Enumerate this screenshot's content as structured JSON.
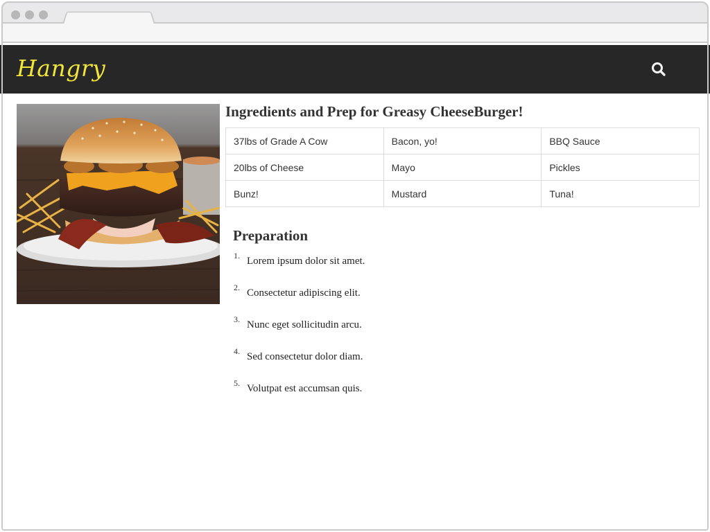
{
  "header": {
    "brand": "Hangry",
    "brand_color": "#f2e53a",
    "background_color": "#272727",
    "search_icon": "search-icon"
  },
  "hero_image": {
    "subject": "cheeseburger with bacon, fried onions and fries"
  },
  "recipe": {
    "title": "Ingredients and Prep for Greasy CheeseBurger!",
    "ingredients": [
      [
        "37lbs of Grade A Cow",
        "Bacon, yo!",
        "BBQ Sauce"
      ],
      [
        "20lbs of Cheese",
        "Mayo",
        "Pickles"
      ],
      [
        "Bunz!",
        "Mustard",
        "Tuna!"
      ]
    ],
    "preparation_heading": "Preparation",
    "steps": [
      {
        "num": "1.",
        "text": "Lorem ipsum dolor sit amet."
      },
      {
        "num": "2.",
        "text": "Consectetur adipiscing elit."
      },
      {
        "num": "3.",
        "text": "Nunc eget sollicitudin arcu."
      },
      {
        "num": "4.",
        "text": "Sed consectetur dolor diam."
      },
      {
        "num": "5.",
        "text": "Volutpat est accumsan quis."
      }
    ]
  }
}
